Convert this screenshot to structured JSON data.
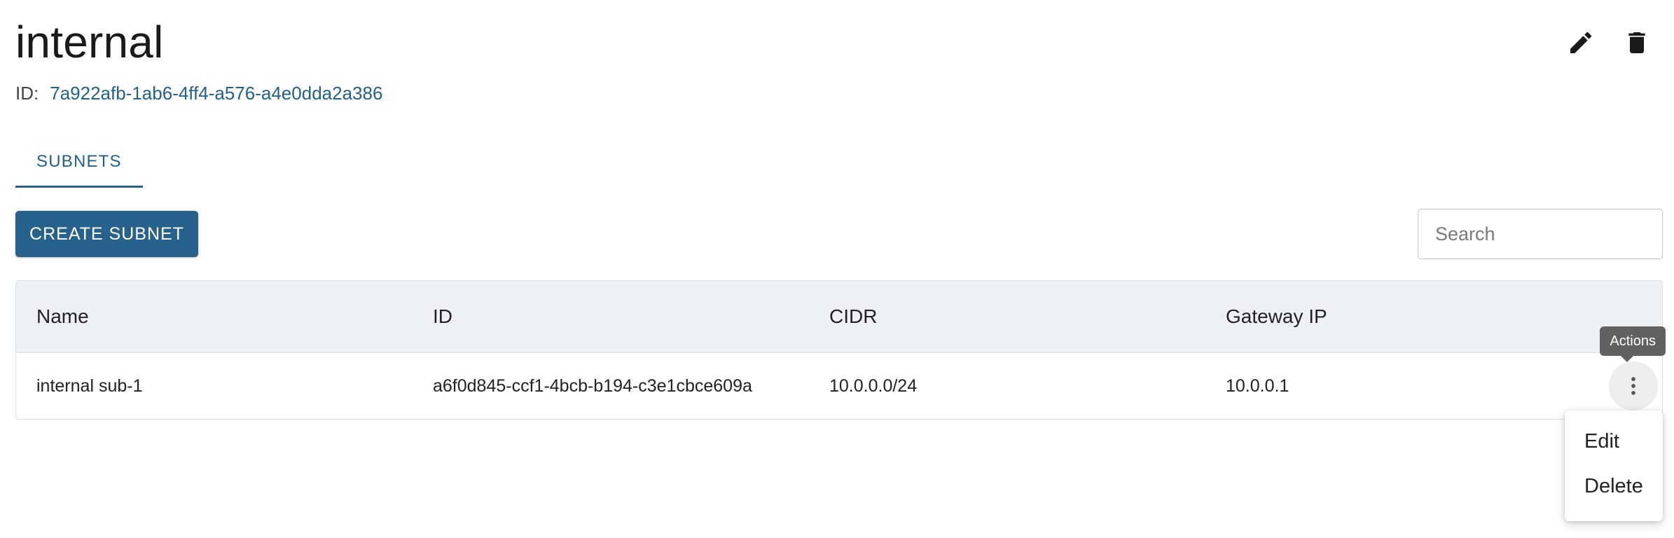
{
  "header": {
    "title": "internal",
    "id_label": "ID:",
    "id_value": "7a922afb-1ab6-4ff4-a576-a4e0dda2a386",
    "icons": [
      "edit-icon",
      "delete-icon"
    ]
  },
  "tabs": [
    {
      "label": "SUBNETS",
      "active": true
    }
  ],
  "toolbar": {
    "create_label": "CREATE SUBNET",
    "search_placeholder": "Search"
  },
  "table": {
    "columns": [
      "Name",
      "ID",
      "CIDR",
      "Gateway IP"
    ],
    "rows": [
      {
        "name": "internal sub-1",
        "id": "a6f0d845-ccf1-4bcb-b194-c3e1cbce609a",
        "cidr": "10.0.0.0/24",
        "gateway_ip": "10.0.0.1"
      }
    ]
  },
  "actions": {
    "tooltip": "Actions",
    "menu": [
      "Edit",
      "Delete"
    ]
  },
  "colors": {
    "accent": "#23608a",
    "button": "#26628b",
    "header_bg": "#eef1f4"
  }
}
